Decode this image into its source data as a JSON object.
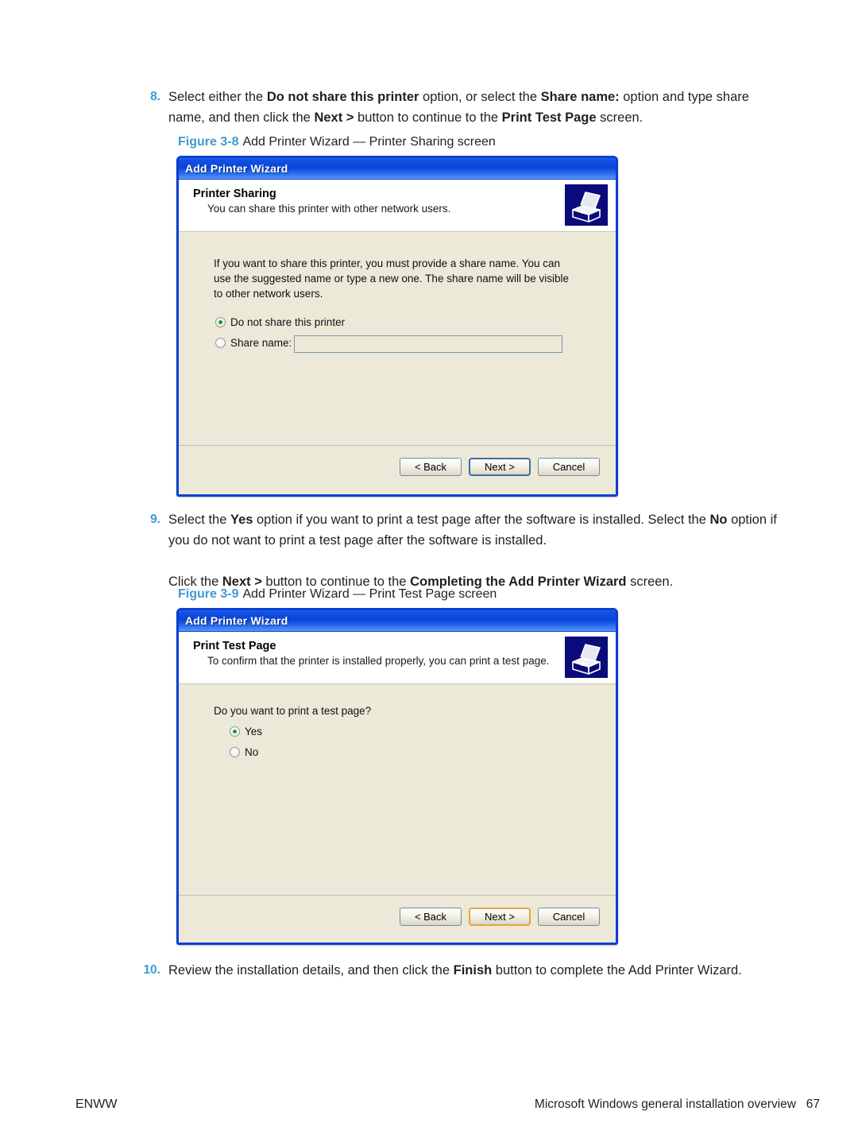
{
  "page": {
    "footer_left": "ENWW",
    "footer_section": "Microsoft Windows general installation overview",
    "footer_pageno": "67",
    "accent_blue": "#3f9ad6",
    "text_color": "#231f20"
  },
  "steps": [
    {
      "number": "8.",
      "paragraphs": [
        [
          {
            "t": "Select either the ",
            "b": false
          },
          {
            "t": "Do not share this printer",
            "b": true
          },
          {
            "t": " option, or select the ",
            "b": false
          },
          {
            "t": "Share name:",
            "b": true
          },
          {
            "t": " option and type share name, and then click the ",
            "b": false
          },
          {
            "t": "Next >",
            "b": true
          },
          {
            "t": " button to continue to the ",
            "b": false
          },
          {
            "t": "Print Test Page",
            "b": true
          },
          {
            "t": " screen.",
            "b": false
          }
        ]
      ]
    },
    {
      "number": "9.",
      "paragraphs": [
        [
          {
            "t": "Select the ",
            "b": false
          },
          {
            "t": "Yes",
            "b": true
          },
          {
            "t": " option if you want to print a test page after the software is installed. Select the ",
            "b": false
          },
          {
            "t": "No",
            "b": true
          },
          {
            "t": " option if you do not want to print a test page after the software is installed.",
            "b": false
          }
        ],
        [
          {
            "t": "Click the ",
            "b": false
          },
          {
            "t": "Next >",
            "b": true
          },
          {
            "t": " button to continue to the ",
            "b": false
          },
          {
            "t": "Completing the Add Printer Wizard",
            "b": true
          },
          {
            "t": " screen.",
            "b": false
          }
        ]
      ]
    },
    {
      "number": "10.",
      "paragraphs": [
        [
          {
            "t": "Review the installation details, and then click the ",
            "b": false
          },
          {
            "t": "Finish",
            "b": true
          },
          {
            "t": " button to complete the Add Printer Wizard.",
            "b": false
          }
        ]
      ]
    }
  ],
  "figures": [
    {
      "number": "Figure 3-8",
      "caption": "Add Printer Wizard — Printer Sharing screen"
    },
    {
      "number": "Figure 3-9",
      "caption": "Add Printer Wizard — Print Test Page screen"
    }
  ],
  "dialog1": {
    "window_title": "Add Printer Wizard",
    "header_title": "Printer Sharing",
    "header_subtitle": "You can share this printer with other network users.",
    "body_text": "If you want to share this printer, you must provide a share name. You can use the suggested name or type a new one. The share name will be visible to other network users.",
    "radio_do_not_share": "Do not share this printer",
    "radio_share_name": "Share name:",
    "share_name_value": "",
    "buttons": {
      "back": "< Back",
      "next": "Next >",
      "cancel": "Cancel"
    },
    "icon": "printer-icon",
    "selected_option": "Do not share this printer",
    "default_button": "Next >",
    "default_button_border": "#3a6ea5"
  },
  "dialog2": {
    "window_title": "Add Printer Wizard",
    "header_title": "Print Test Page",
    "header_subtitle": "To confirm that the printer is installed properly, you can print a test page.",
    "question": "Do you want to print a test page?",
    "radio_yes": "Yes",
    "radio_no": "No",
    "buttons": {
      "back": "< Back",
      "next": "Next >",
      "cancel": "Cancel"
    },
    "icon": "printer-icon",
    "selected_option": "Yes",
    "default_button": "Next >",
    "default_button_border": "#e8a33d"
  }
}
